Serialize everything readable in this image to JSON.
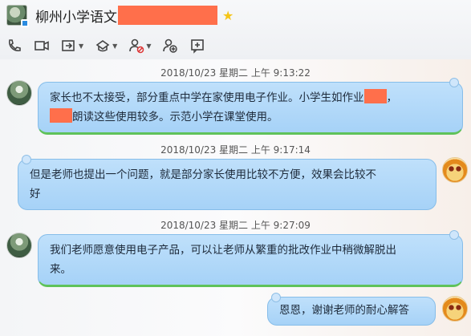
{
  "header": {
    "title": "柳州小学语文",
    "toolbar": [
      {
        "icon": "phone-icon"
      },
      {
        "icon": "video-icon"
      },
      {
        "icon": "share-screen-icon"
      },
      {
        "icon": "app-icon"
      },
      {
        "icon": "add-member-icon"
      },
      {
        "icon": "invite-icon"
      },
      {
        "icon": "add-window-icon"
      }
    ]
  },
  "messages": [
    {
      "timestamp": "2018/10/23 星期二 上午 9:13:22",
      "side": "left",
      "line1": "家长也不太接受，部分重点中学在家使用电子作业。小学生如作业",
      "line1b": "，",
      "line2": "朗读这些使用较多。示范小学在课堂使用。"
    },
    {
      "timestamp": "2018/10/23 星期二 上午 9:17:14",
      "side": "right",
      "line1": "但是老师也提出一个问题，就是部分家长使用比较不方便，效果会比较不",
      "line2": "好"
    },
    {
      "timestamp": "2018/10/23 星期二 上午 9:27:09",
      "side": "left",
      "line1": "我们老师愿意使用电子产品，可以让老师从繁重的批改作业中稍微解脱出",
      "line2": "来。"
    },
    {
      "side": "right",
      "line1": "恩恩，谢谢老师的耐心解答"
    }
  ],
  "colors": {
    "bubble": "#a6d2f7",
    "bubble_border": "#86bde9",
    "redaction": "#ff6f4b",
    "green_underline": "#5fc25a"
  }
}
